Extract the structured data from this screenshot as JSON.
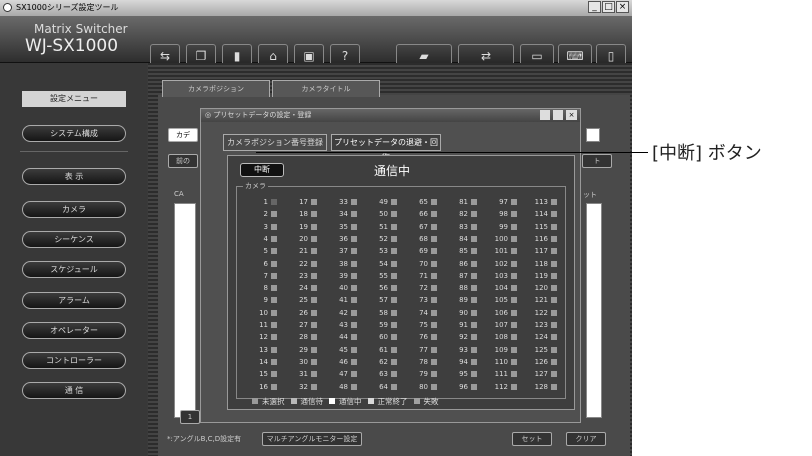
{
  "window": {
    "title": "SX1000シリーズ設定ツール",
    "min": "_",
    "max": "□",
    "close": "×"
  },
  "brand": {
    "line1": "Matrix Switcher",
    "line2": "WJ-SX1000"
  },
  "toolbar": {
    "icons": [
      "camera-switch-icon",
      "copy-icon",
      "document-icon",
      "folder-open-icon",
      "save-icon",
      "help-icon",
      "comm-icon",
      "transfer-icon",
      "monitor-icon",
      "keyboard-icon",
      "panel-icon"
    ]
  },
  "sidebar": {
    "header": "設定メニュー",
    "items": [
      "システム構成",
      "表 示",
      "カメラ",
      "シーケンス",
      "スケジュール",
      "アラーム",
      "オペレーター",
      "コントローラー",
      "通 信"
    ]
  },
  "main": {
    "tabs": [
      "カメラポジション",
      "カメラタイトル"
    ],
    "left_label": "カデ",
    "prev_button": "前の",
    "right_button": "ト",
    "col_header_left": "CA",
    "col_header_right": "ット",
    "page_button": "1",
    "footnote": "*:アングルB,C,D設定有",
    "multi_angle_button": "マルチアングルモニター設定",
    "set_button": "セット",
    "clear_button": "クリア"
  },
  "dialog": {
    "title": "プリセットデータの設定・登録",
    "tabs": [
      "カメラポジション番号登録",
      "プリセットデータの退避・回復"
    ]
  },
  "comm": {
    "suspend_button": "中断",
    "title": "通信中",
    "group_label": "カメラ",
    "cameras": {
      "count": 128,
      "per_column": 16
    },
    "camera1_status": "selected",
    "status_colors": {
      "unselected": "#9a9a9a",
      "waiting": "#b8b8b8",
      "communicating": "#ffffff",
      "done": "#d8d8d8",
      "failed": "#a0a0a0",
      "selected": "#666666"
    },
    "legend": [
      {
        "label": "未選択",
        "color": "#9a9a9a"
      },
      {
        "label": "通信待",
        "color": "#b8b8b8"
      },
      {
        "label": "通信中",
        "color": "#ffffff"
      },
      {
        "label": "正常終了",
        "color": "#d8d8d8"
      },
      {
        "label": "失敗",
        "color": "#a0a0a0"
      }
    ]
  },
  "annotation": {
    "label": "[中断] ボタン"
  }
}
